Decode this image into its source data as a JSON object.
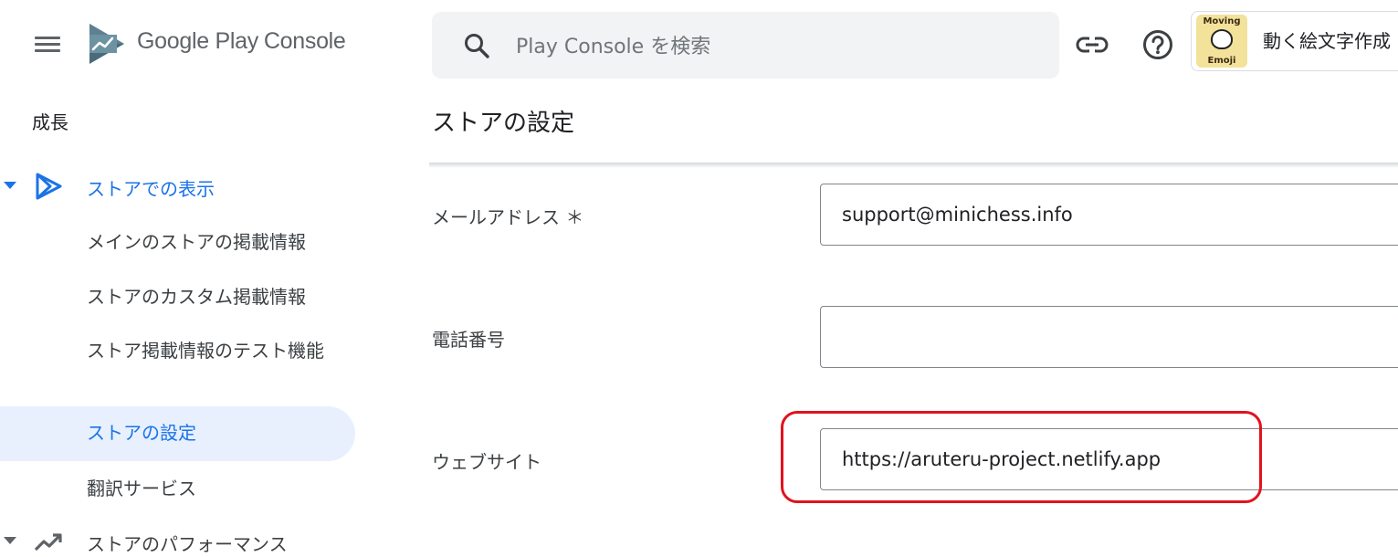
{
  "header": {
    "brand_google_play": "Google Play",
    "brand_console": "Console",
    "search_placeholder": "Play Console を検索",
    "app_name": "動く絵文字作成",
    "app_icon_text_top": "Moving",
    "app_icon_text_bottom": "Emoji"
  },
  "sidebar": {
    "section": "成長",
    "store_presence": {
      "label": "ストアでの表示",
      "icon": "play-triangle-icon",
      "items": [
        {
          "label": "メインのストアの掲載情報",
          "active": false
        },
        {
          "label": "ストアのカスタム掲載情報",
          "active": false
        },
        {
          "label": "ストア掲載情報のテスト機能",
          "active": false
        },
        {
          "label": "ストアの設定",
          "active": true
        },
        {
          "label": "翻訳サービス",
          "active": false
        }
      ]
    },
    "store_performance": {
      "label": "ストアのパフォーマンス",
      "icon": "trending-up-icon"
    }
  },
  "main": {
    "title": "ストアの設定",
    "fields": {
      "email": {
        "label": "メールアドレス ＊",
        "value": "support@minichess.info"
      },
      "phone": {
        "label": "電話番号",
        "value": ""
      },
      "website": {
        "label": "ウェブサイト",
        "value": "https://aruteru-project.netlify.app"
      }
    }
  },
  "colors": {
    "accent": "#1a73e8",
    "active_bg": "#e8f0fe",
    "highlight": "#e0131d",
    "search_bg": "#f1f3f4"
  }
}
